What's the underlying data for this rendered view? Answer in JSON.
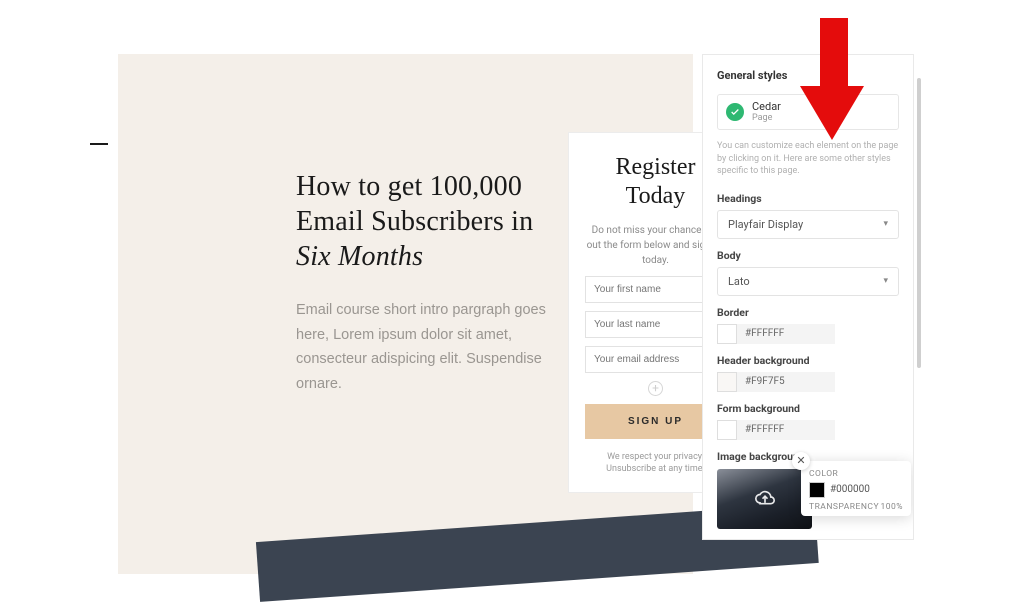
{
  "hero": {
    "title_plain": "How to get 100,000 Email Subscribers in",
    "title_em": "Six Months",
    "intro": "Email course short intro pargraph goes here, Lorem ipsum dolor sit amet, consecteur adispicing elit. Suspendise ornare."
  },
  "form": {
    "title": "Register Today",
    "subtext": "Do not miss your chance. Fill out the form below and sign up today.",
    "placeholders": {
      "first": "Your first name",
      "last": "Your last name",
      "email": "Your email address"
    },
    "button": "SIGN UP",
    "privacy": "We respect your privacy. Unsubscribe at any time."
  },
  "panel": {
    "title": "General styles",
    "template": {
      "name": "Cedar",
      "sub": "Page"
    },
    "helper": "You can customize each element on the page by clicking on it. Here are some other styles specific to this page.",
    "headings": {
      "label": "Headings",
      "value": "Playfair Display"
    },
    "body_font": {
      "label": "Body",
      "value": "Lato"
    },
    "border": {
      "label": "Border",
      "hex": "#FFFFFF"
    },
    "header_bg": {
      "label": "Header background",
      "hex": "#F9F7F5"
    },
    "form_bg": {
      "label": "Form background",
      "hex": "#FFFFFF"
    },
    "image_bg": {
      "label": "Image background"
    },
    "popover": {
      "color_label": "COLOR",
      "color_hex": "#000000",
      "transparency_label": "TRANSPARENCY",
      "transparency_value": "100%"
    }
  }
}
